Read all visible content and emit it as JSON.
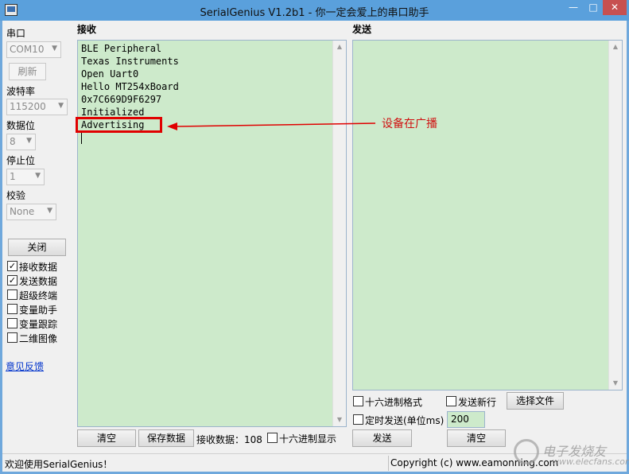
{
  "window": {
    "title": "SerialGenius V1.2b1 - 你一定会爱上的串口助手",
    "min_glyph": "—",
    "max_glyph": "□",
    "close_glyph": "✕"
  },
  "left": {
    "port_label": "串口",
    "port_value": "COM10",
    "refresh_label": "刷新",
    "baud_label": "波特率",
    "baud_value": "115200",
    "databits_label": "数据位",
    "databits_value": "8",
    "stopbits_label": "停止位",
    "stopbits_value": "1",
    "parity_label": "校验",
    "parity_value": "None",
    "close_label": "关闭",
    "checkboxes": [
      {
        "label": "接收数据",
        "checked": "✓"
      },
      {
        "label": "发送数据",
        "checked": "✓"
      },
      {
        "label": "超级终端",
        "checked": ""
      },
      {
        "label": "变量助手",
        "checked": ""
      },
      {
        "label": "变量跟踪",
        "checked": ""
      },
      {
        "label": "二维图像",
        "checked": ""
      }
    ],
    "feedback_link": "意见反馈"
  },
  "receive": {
    "title": "接收",
    "lines": "BLE Peripheral\nTexas Instruments\nOpen Uart0\nHello MT254xBoard\n0x7C669D9F6297\nInitialized\nAdvertising",
    "clear_label": "清空",
    "save_label": "保存数据",
    "count_label": "接收数据：108",
    "hex_display_label": "十六进制显示"
  },
  "send": {
    "title": "发送",
    "hex_format_label": "十六进制格式",
    "newline_label": "发送新行",
    "choose_file_label": "选择文件",
    "timed_send_label": "定时发送(单位ms)",
    "interval_value": "200",
    "send_label": "发送",
    "clear_label": "清空"
  },
  "annotation": {
    "text": "设备在广播",
    "color": "#d01010"
  },
  "status": {
    "left_text": "欢迎使用SerialGenius！",
    "right_text": "Copyright (c) www.eamonning.com"
  },
  "watermark": {
    "text": "电子发烧友",
    "url": "www.elecfans.com"
  },
  "scroll": {
    "up_glyph": "▲",
    "down_glyph": "▼"
  }
}
